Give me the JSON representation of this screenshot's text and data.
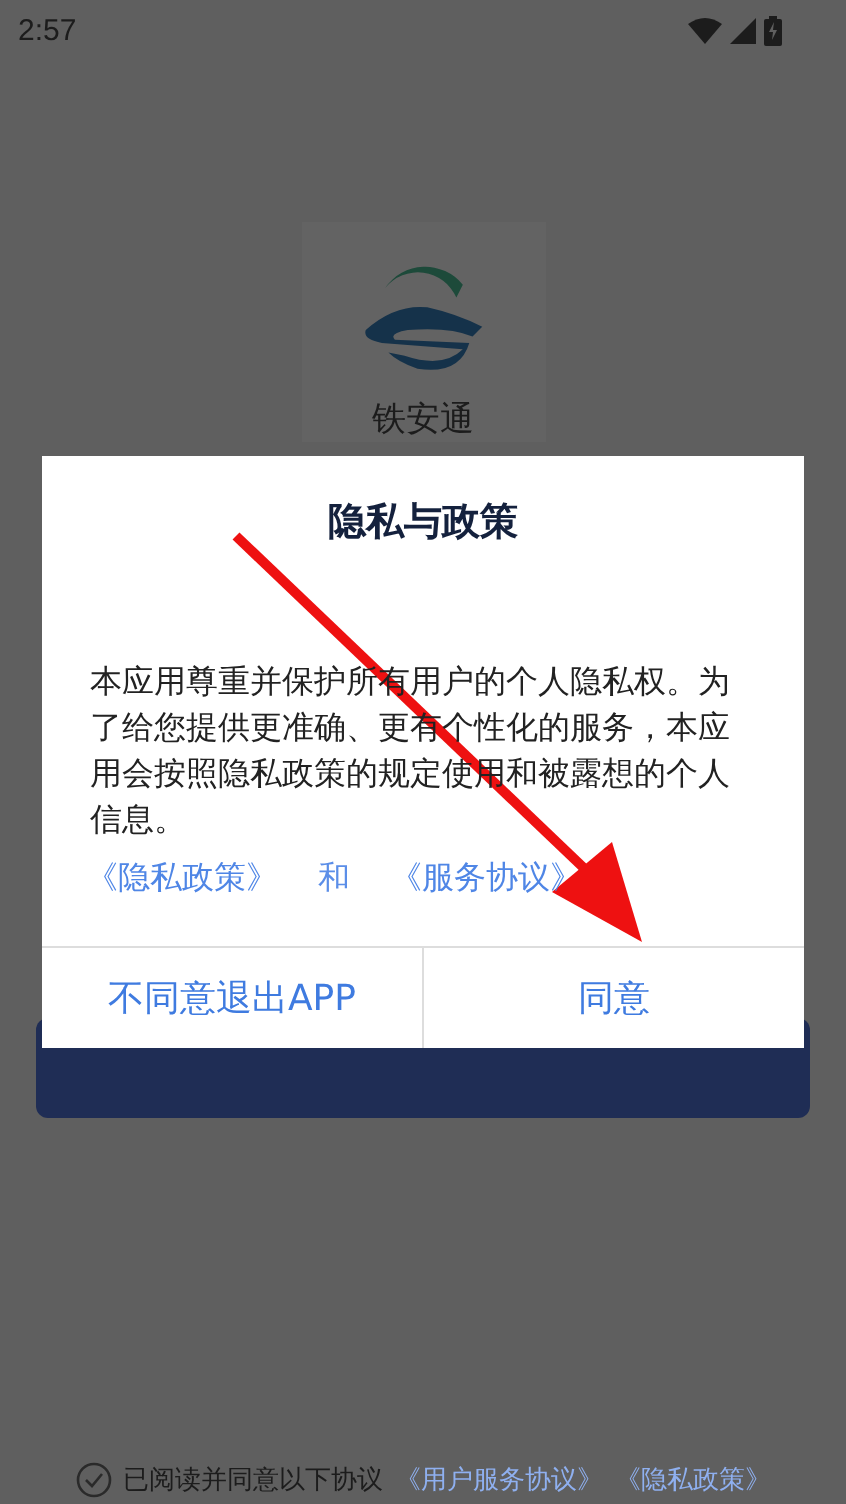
{
  "status_bar": {
    "time": "2:57"
  },
  "app": {
    "name": "铁安通"
  },
  "dialog": {
    "title": "隐私与政策",
    "body": "本应用尊重并保护所有用户的个人隐私权。为了给您提供更准确、更有个性化的服务，本应用会按照隐私政策的规定使用和被露想的个人信息。",
    "links": [
      {
        "kind": "link",
        "text": "《隐私政策》"
      },
      {
        "kind": "text",
        "text": "和"
      },
      {
        "kind": "link",
        "text": "《服务协议》"
      }
    ],
    "buttons": [
      {
        "label": "不同意退出APP"
      },
      {
        "label": "同意"
      }
    ]
  },
  "agreement": {
    "text": "已阅读并同意以下协议",
    "links": [
      "《用户服务协议》",
      "《隐私政策》"
    ]
  }
}
